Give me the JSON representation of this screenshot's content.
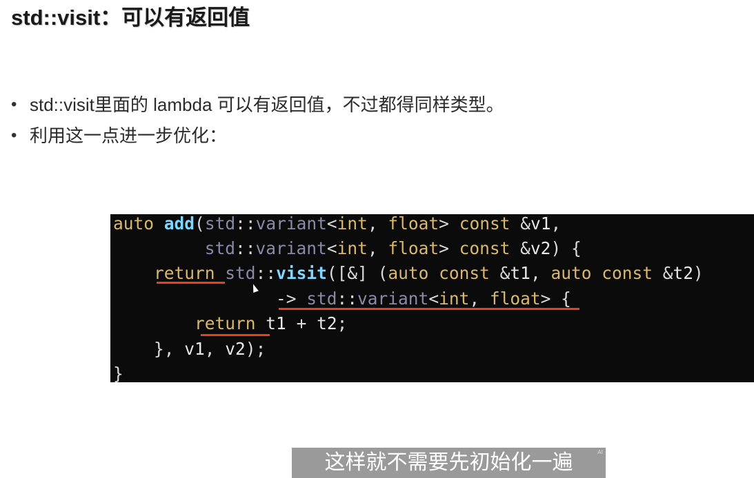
{
  "slide": {
    "title": "std::visit：可以有返回值",
    "bullets": [
      "std::visit里面的 lambda 可以有返回值，不过都得同样类型。",
      "利用这一点进一步优化："
    ]
  },
  "code": {
    "lines": [
      "auto add(std::variant<int, float> const &v1,",
      "         std::variant<int, float> const &v2) {",
      "    return std::visit([&] (auto const &t1, auto const &t2)",
      "                -> std::variant<int, float> {",
      "        return t1 + t2;",
      "    }, v1, v2);",
      "}"
    ]
  },
  "subtitle": {
    "text": "这样就不需要先初始化一遍",
    "mark": "AI"
  },
  "colors": {
    "code_background": "#0b0b0b",
    "keyword": "#d9b86c",
    "function": "#7fd6ff",
    "underline": "#e8421c",
    "subtitle_background": "#9a9a9a"
  },
  "icons": {
    "cursor": "mouse-pointer-icon"
  }
}
